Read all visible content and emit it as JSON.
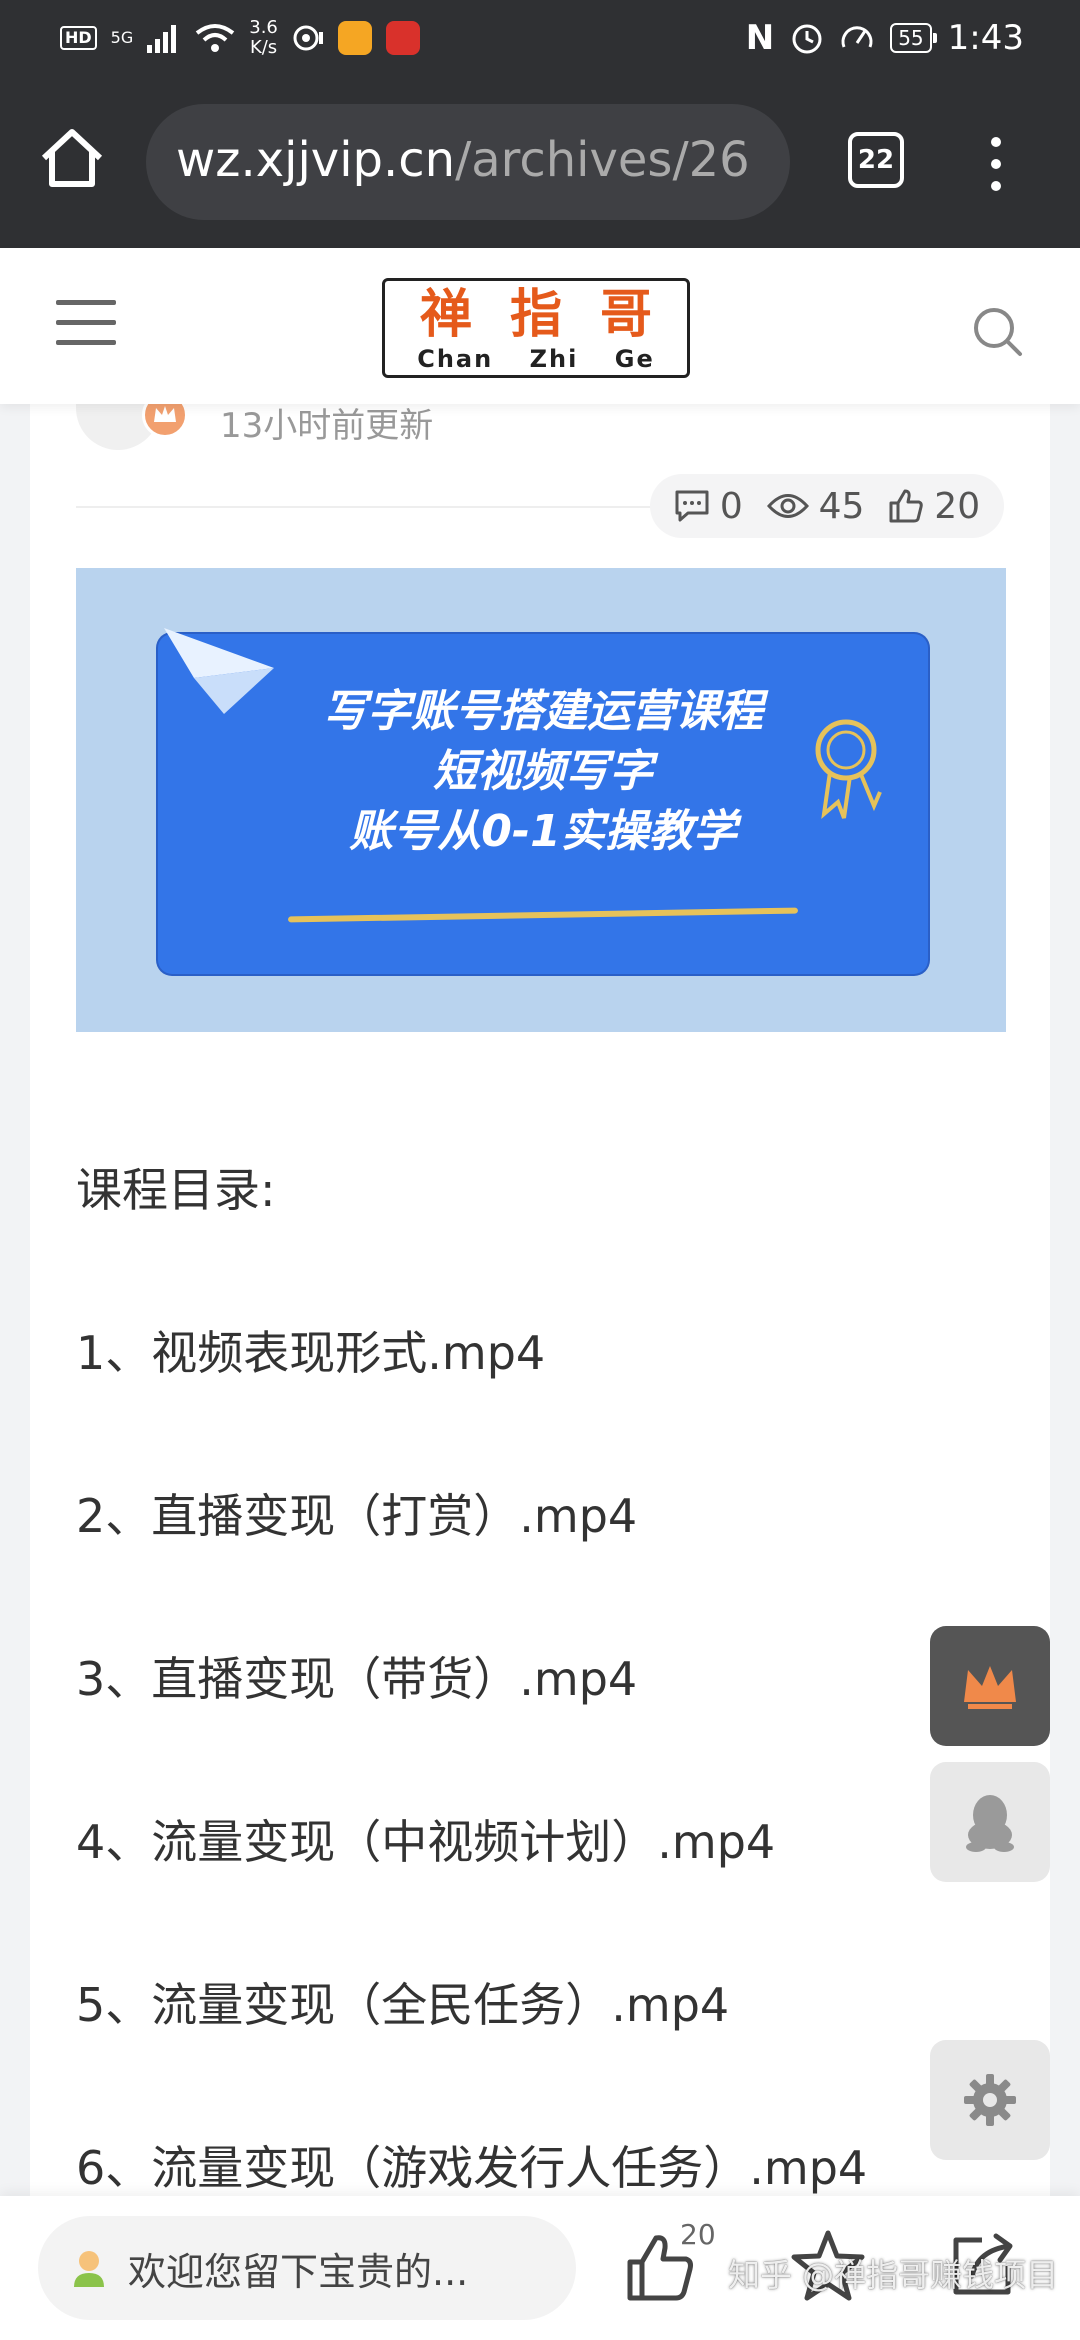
{
  "status_bar": {
    "hd": "HD",
    "signal": "5G",
    "speed_value": "3.6",
    "speed_unit": "K/s",
    "battery": "55",
    "time": "1:43"
  },
  "browser": {
    "url_host": "wz.xjjvip.cn",
    "url_path": "/archives/26",
    "tab_count": "22"
  },
  "site": {
    "logo_chars": [
      "禅",
      "指",
      "哥"
    ],
    "logo_en": [
      "Chan",
      "Zhi",
      "Ge"
    ]
  },
  "article": {
    "updated": "13小时前更新",
    "stats": {
      "comments": "0",
      "views": "45",
      "likes": "20"
    },
    "banner_lines": [
      "写字账号搭建运营课程",
      "短视频写字",
      "账号从0-1实操教学"
    ],
    "content": [
      "课程目录:",
      "1、视频表现形式.mp4",
      "2、直播变现（打赏）.mp4",
      "3、直播变现（带货）.mp4",
      "4、流量变现（中视频计划）.mp4",
      "5、流量变现（全民任务）.mp4",
      "6、流量变现（游戏发行人任务）.mp4"
    ]
  },
  "bottom_bar": {
    "comment_placeholder": "欢迎您留下宝贵的...",
    "like_count": "20",
    "watermark": "知乎 @禅指哥赚钱项目"
  },
  "colors": {
    "chrome": "#2f3033",
    "logo_orange": "#e55a1b",
    "banner_blue": "#3375e8",
    "vip_orange": "#f0894a"
  }
}
